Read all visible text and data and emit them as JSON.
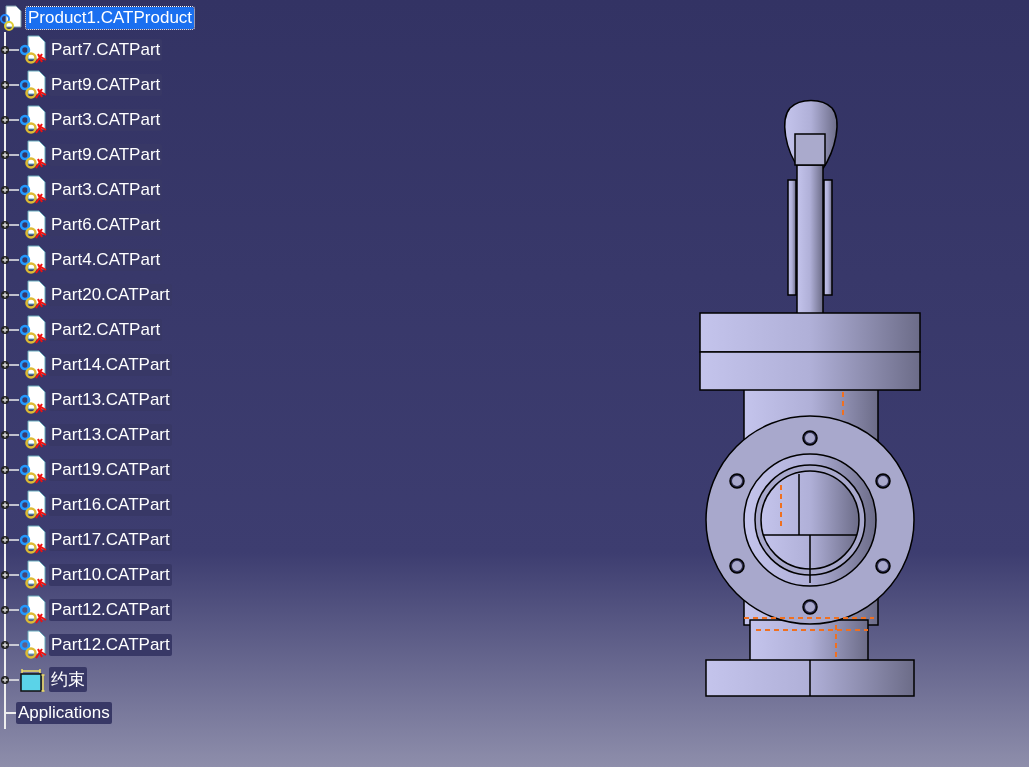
{
  "tree": {
    "root": {
      "label": "Product1.CATProduct",
      "selected": true
    },
    "children": [
      {
        "label": "Part7.CATPart",
        "kind": "part",
        "expanded": false
      },
      {
        "label": "Part9.CATPart",
        "kind": "part",
        "expanded": false
      },
      {
        "label": "Part3.CATPart",
        "kind": "part",
        "expanded": false
      },
      {
        "label": "Part9.CATPart",
        "kind": "part",
        "expanded": false
      },
      {
        "label": "Part3.CATPart",
        "kind": "part",
        "expanded": false
      },
      {
        "label": "Part6.CATPart",
        "kind": "part",
        "expanded": false
      },
      {
        "label": "Part4.CATPart",
        "kind": "part",
        "expanded": false
      },
      {
        "label": "Part20.CATPart",
        "kind": "part",
        "expanded": false
      },
      {
        "label": "Part2.CATPart",
        "kind": "part",
        "expanded": false
      },
      {
        "label": "Part14.CATPart",
        "kind": "part",
        "expanded": false
      },
      {
        "label": "Part13.CATPart",
        "kind": "part",
        "expanded": false
      },
      {
        "label": "Part13.CATPart",
        "kind": "part",
        "expanded": false
      },
      {
        "label": "Part19.CATPart",
        "kind": "part",
        "expanded": false
      },
      {
        "label": "Part16.CATPart",
        "kind": "part",
        "expanded": false
      },
      {
        "label": "Part17.CATPart",
        "kind": "part",
        "expanded": false
      },
      {
        "label": "Part10.CATPart",
        "kind": "part",
        "expanded": false
      },
      {
        "label": "Part12.CATPart",
        "kind": "part",
        "expanded": false
      },
      {
        "label": "Part12.CATPart",
        "kind": "part",
        "expanded": false
      },
      {
        "label": "约束",
        "kind": "constraints",
        "expanded": false
      }
    ],
    "applications": {
      "label": "Applications"
    }
  }
}
